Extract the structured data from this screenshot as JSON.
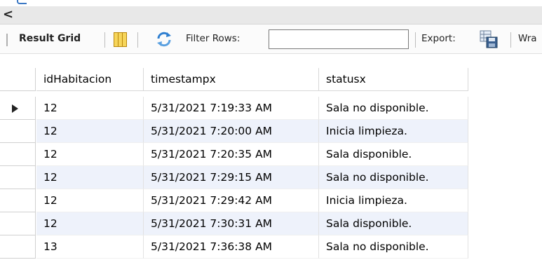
{
  "scrollbar": {
    "left_arrow": "<"
  },
  "toolbar": {
    "result_grid_label": "Result Grid",
    "grid_icon": "grid-layout-icon",
    "refresh_icon": "refresh-icon",
    "filter_label": "Filter Rows:",
    "filter_value": "",
    "export_label": "Export:",
    "export_icon": "export-icon",
    "wrap_label": "Wra"
  },
  "table": {
    "columns": [
      "idHabitacion",
      "timestampx",
      "statusx"
    ],
    "rows": [
      [
        "12",
        "5/31/2021 7:19:33 AM",
        "Sala no disponible."
      ],
      [
        "12",
        "5/31/2021 7:20:00 AM",
        "Inicia limpieza."
      ],
      [
        "12",
        "5/31/2021 7:20:35 AM",
        "Sala disponible."
      ],
      [
        "12",
        "5/31/2021 7:29:15 AM",
        "Sala no disponible."
      ],
      [
        "12",
        "5/31/2021 7:29:42 AM",
        "Inicia limpieza."
      ],
      [
        "12",
        "5/31/2021 7:30:31 AM",
        "Sala disponible."
      ],
      [
        "13",
        "5/31/2021 7:36:38 AM",
        "Sala no disponible."
      ]
    ],
    "current_row_index": 0
  },
  "colors": {
    "alt_row": "#eef2fb",
    "toolbar_bg": "#fbfbfb",
    "scroll_bg": "#e8e8e8"
  }
}
